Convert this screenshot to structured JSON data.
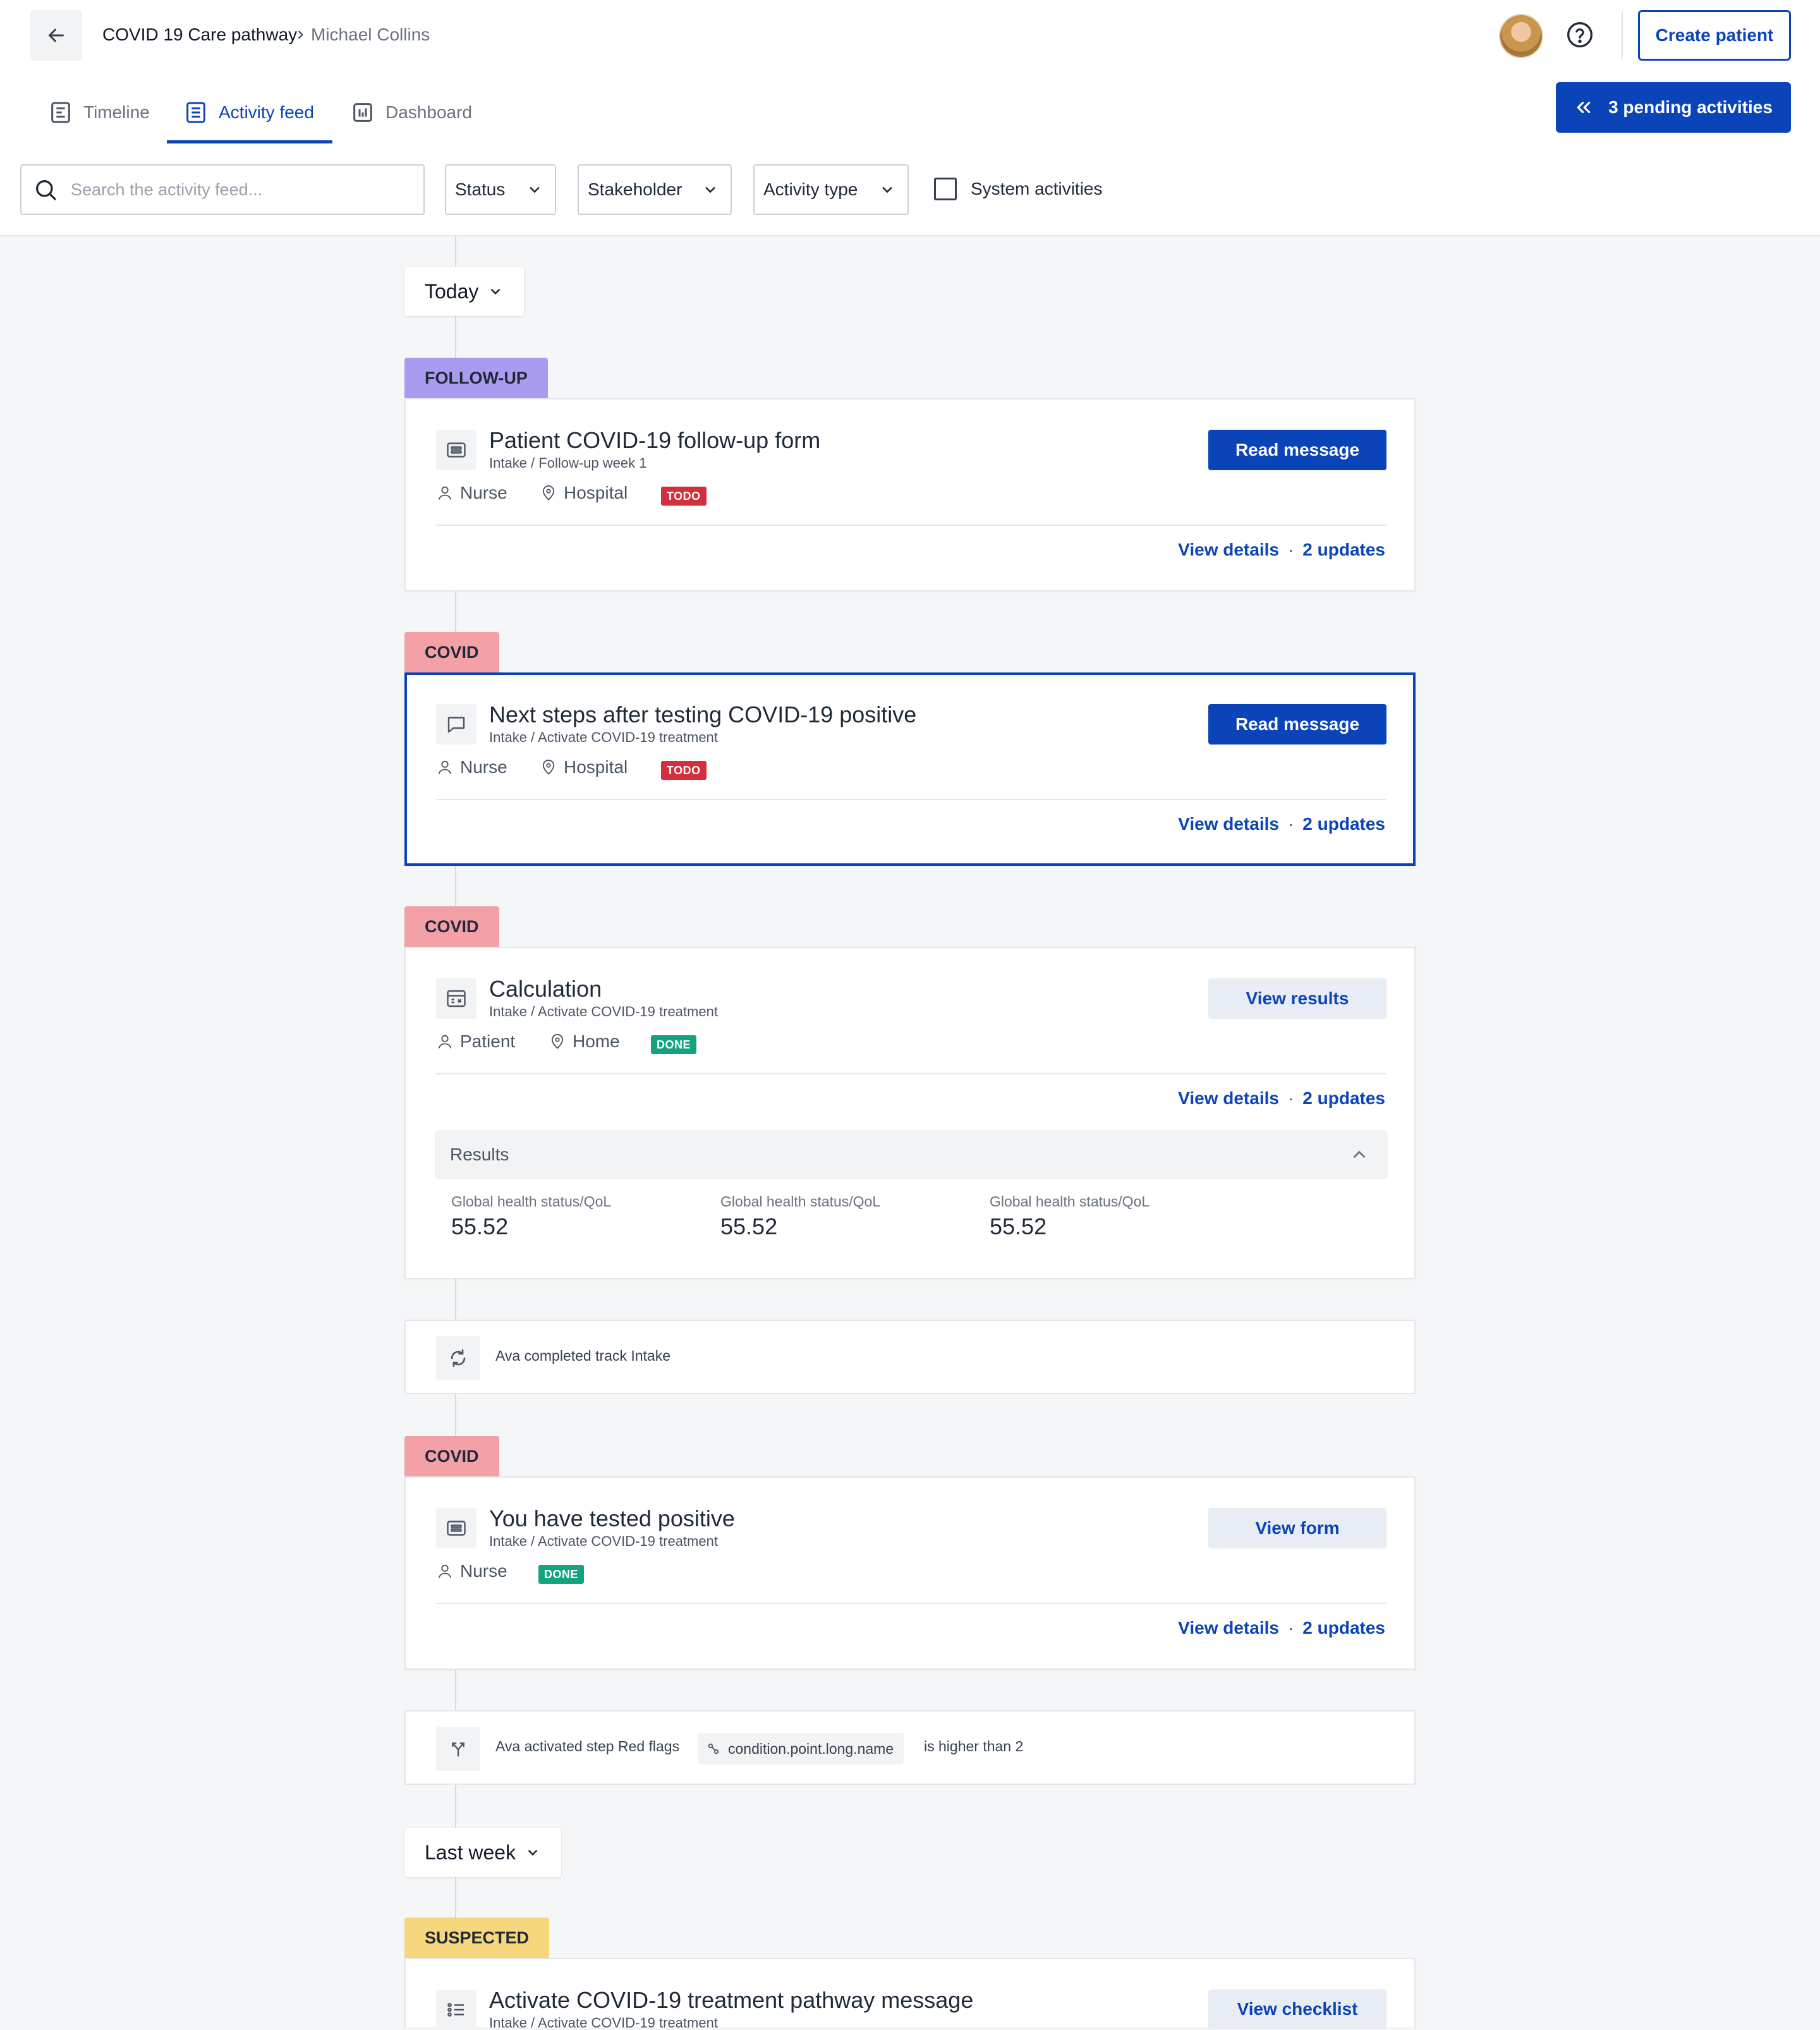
{
  "header": {
    "breadcrumb": [
      "COVID 19 Care pathway",
      "Michael Collins"
    ],
    "create_button": "Create patient",
    "pending_button": "3 pending activities"
  },
  "tabs": [
    {
      "label": "Timeline",
      "icon": "timeline-icon"
    },
    {
      "label": "Activity feed",
      "icon": "activity-feed-icon",
      "active": true
    },
    {
      "label": "Dashboard",
      "icon": "dashboard-icon"
    }
  ],
  "filters": {
    "search_placeholder": "Search the activity feed...",
    "status": "Status",
    "stakeholder": "Stakeholder",
    "activity_type": "Activity type",
    "system_activities": "System activities",
    "system_activities_checked": false
  },
  "groups": {
    "today": "Today",
    "last_week": "Last week"
  },
  "cards": [
    {
      "tag": "FOLLOW-UP",
      "tag_color": "#a99cf0",
      "icon": "form-icon",
      "title": "Patient COVID-19 follow-up form",
      "subtitle": "Intake / Follow-up week 1",
      "stakeholder": "Nurse",
      "location": "Hospital",
      "status": "TODO",
      "action": "Read message",
      "links": {
        "details": "View details",
        "updates": "2 updates"
      }
    },
    {
      "tag": "COVID",
      "tag_color": "#f3a0a7",
      "icon": "message-icon",
      "title": "Next steps after testing COVID-19 positive",
      "subtitle": "Intake / Activate COVID-19 treatment",
      "stakeholder": "Nurse",
      "location": "Hospital",
      "status": "TODO",
      "action": "Read message",
      "links": {
        "details": "View details",
        "updates": "2 updates"
      }
    },
    {
      "tag": "COVID",
      "tag_color": "#f3a0a7",
      "icon": "calculator-icon",
      "title": "Calculation",
      "subtitle": "Intake / Activate COVID-19 treatment",
      "stakeholder": "Patient",
      "location": "Home",
      "status": "DONE",
      "action": "View results",
      "links": {
        "details": "View details",
        "updates": "2 updates"
      },
      "results": {
        "heading": "Results",
        "items": [
          {
            "label": "Global health status/QoL",
            "value": "55.52"
          },
          {
            "label": "Global health status/QoL",
            "value": "55.52"
          },
          {
            "label": "Global health status/QoL",
            "value": "55.52"
          }
        ]
      }
    },
    {
      "tag": "COVID",
      "tag_color": "#f3a0a7",
      "icon": "form-icon",
      "title": "You have tested positive",
      "subtitle": "Intake / Activate COVID-19 treatment",
      "stakeholder": "Nurse",
      "status": "DONE",
      "action": "View form",
      "links": {
        "details": "View details",
        "updates": "2 updates"
      }
    },
    {
      "tag": "SUSPECTED",
      "tag_color": "#f7d77e",
      "icon": "checklist-icon",
      "title": "Activate COVID-19 treatment pathway message",
      "subtitle": "Intake / Activate COVID-19 treatment",
      "action": "View checklist"
    }
  ],
  "system_rows": [
    {
      "icon": "refresh-icon",
      "text": "Ava completed track Intake"
    },
    {
      "icon": "branch-icon",
      "text_before": "Ava activated step Red flags",
      "chip": "condition.point.long.name",
      "text_after": "is higher than 2"
    }
  ],
  "colors": {
    "primary": "#0b44b8",
    "todo": "#d42f3a",
    "done": "#14a37f",
    "background": "#f5f6f7"
  }
}
